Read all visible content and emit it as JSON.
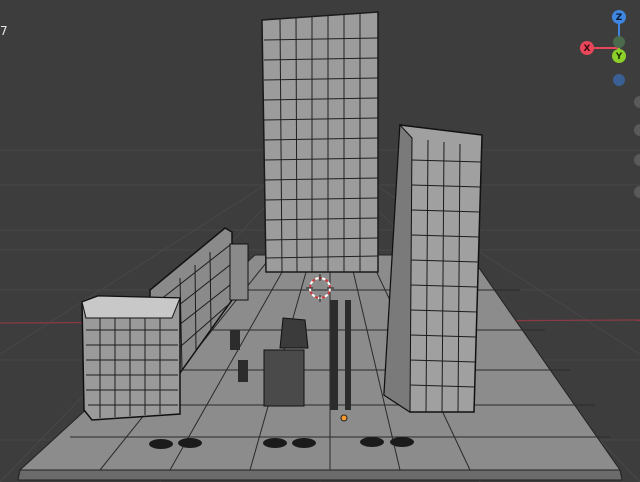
{
  "viewport": {
    "corner_text": "7",
    "background_color": "#3d3d3d",
    "floor_line_color": "#4a4a4a",
    "x_axis_line_color": "#8a3b45"
  },
  "gizmo": {
    "x_label": "X",
    "y_label": "Y",
    "z_label": "Z",
    "x_color": "#e8475a",
    "y_color": "#8ccf2a",
    "z_color": "#3f86e0"
  },
  "scene": {
    "icons": [
      "3d-cursor-icon",
      "origin-point-icon",
      "navigation-gizmo-icon"
    ]
  }
}
